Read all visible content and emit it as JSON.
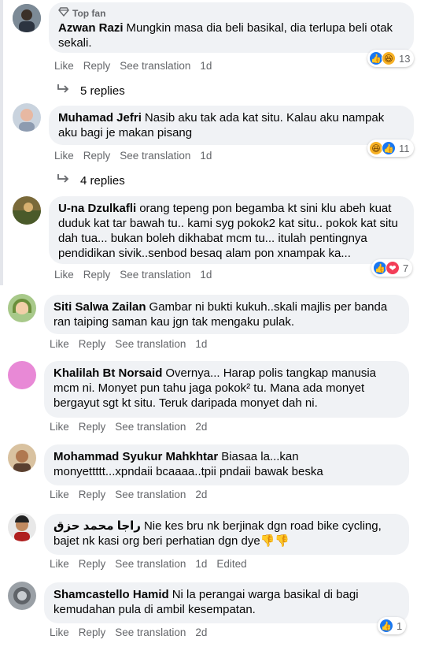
{
  "ui": {
    "like": "Like",
    "reply": "Reply",
    "see_translation": "See translation"
  },
  "comments": [
    {
      "badge": "Top fan",
      "name": "Azwan Razi",
      "text": "Mungkin masa dia beli basikal, dia terlupa beli otak sekali.",
      "time": "1d",
      "reaction_count": "13",
      "replies": "5 replies"
    },
    {
      "name": "Muhamad Jefri",
      "text": "Nasib aku tak ada kat situ. Kalau aku nampak aku bagi je makan pisang",
      "time": "1d",
      "reaction_count": "11",
      "replies": "4 replies"
    },
    {
      "name": "U-na Dzulkafli",
      "text": "orang tepeng pon begamba kt sini klu abeh kuat duduk kat tar bawah tu.. kami syg pokok2 kat situ.. pokok kat situ dah tua... bukan boleh dikhabat mcm tu... itulah pentingnya pendidikan sivik..senbod besaq alam pon xnampak ka...",
      "time": "1d",
      "reaction_count": "7"
    },
    {
      "name": "Siti Salwa Zailan",
      "text": "Gambar ni bukti kukuh..skali majlis per banda ran taiping saman kau jgn tak mengaku pulak.",
      "time": "1d"
    },
    {
      "name": "Khalilah Bt Norsaid",
      "text": "Overnya... Harap polis tangkap manusia mcm ni. Monyet pun tahu jaga pokok² tu. Mana ada monyet bergayut sgt kt situ. Teruk daripada monyet dah ni.",
      "time": "2d"
    },
    {
      "name": "Mohammad Syukur Mahkhtar",
      "text": "Biasaa la...kan monyettttt...xpndaii bcaaaa..tpii pndaii bawak beska",
      "time": "2d"
    },
    {
      "name": "راجا محمد حزق",
      "text": "Nie kes bru nk berjinak dgn road bike cycling, bajet nk kasi org beri perhatian dgn dye",
      "emoji": "👎👎",
      "time": "1d",
      "edited": "Edited"
    },
    {
      "name": "Shamcastello Hamid",
      "text": "Ni la perangai warga basikal di bagi kemudahan pula di ambil kesempatan.",
      "time": "2d",
      "reaction_count": "1"
    }
  ]
}
